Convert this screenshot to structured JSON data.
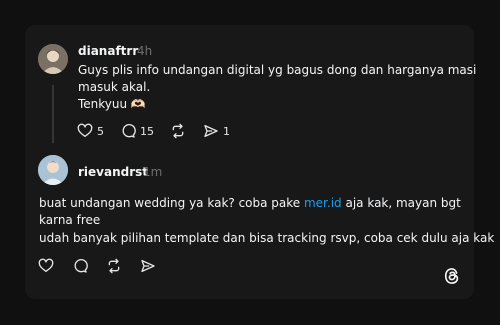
{
  "post1": {
    "username": "dianaftrr",
    "time": "4h",
    "lines": [
      "Guys plis info undangan digital yg bagus dong dan harganya masi",
      "masuk akal.",
      "Tenkyuu 🫶🏻"
    ],
    "likes": "5",
    "replies": "15",
    "shares": "1"
  },
  "post2": {
    "username": "rievandrst",
    "time": "1m",
    "line1_before": "buat undangan wedding ya kak? coba pake ",
    "line1_link": "mer.id",
    "line1_after": " aja kak, mayan bgt",
    "line2": "karna free",
    "line3": "udah banyak pilihan template dan bisa tracking rsvp, coba cek dulu aja kak"
  },
  "icons": {
    "like": "heart-icon",
    "reply": "comment-icon",
    "repost": "repost-icon",
    "share": "send-icon",
    "brand": "threads-logo-icon"
  }
}
